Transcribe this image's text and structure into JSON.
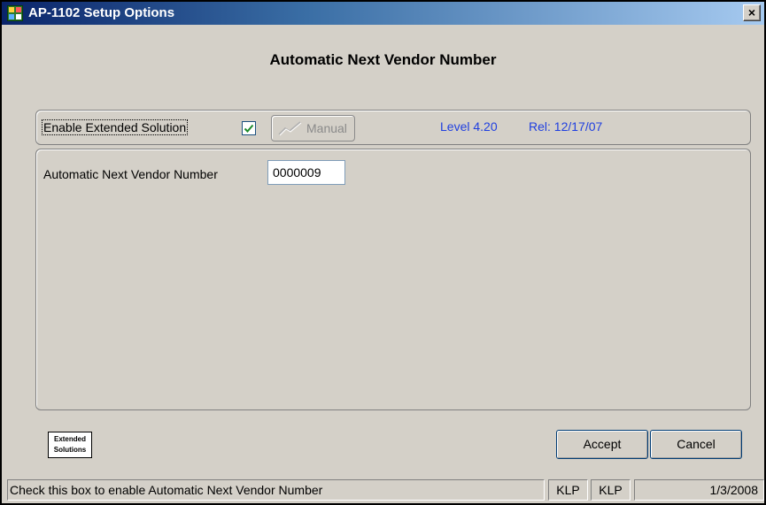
{
  "window": {
    "title": "AP-1102 Setup Options",
    "close_glyph": "×"
  },
  "heading": "Automatic Next Vendor Number",
  "options": {
    "enable_label": "Enable Extended Solution",
    "enable_checked": true,
    "manual_button": "Manual",
    "level": "Level 4.20",
    "release": "Rel: 12/17/07"
  },
  "fields": {
    "vendor_label": "Automatic Next Vendor Number",
    "vendor_value": "0000009"
  },
  "logo": {
    "line1": "Extended",
    "line2": "Solutions"
  },
  "buttons": {
    "accept": "Accept",
    "cancel": "Cancel"
  },
  "status": {
    "message": "Check this box to enable Automatic Next Vendor Number",
    "user1": "KLP",
    "user2": "KLP",
    "date": "1/3/2008"
  },
  "colors": {
    "titlebar_start": "#0a246a",
    "titlebar_end": "#a6caf0",
    "dialog_bg": "#d4d0c8",
    "info_text": "#1f3fe0",
    "checkmark": "#1c8a2a"
  },
  "icons": {
    "app": "app-icon",
    "close": "close-icon",
    "check": "checkmark-icon",
    "manual": "manual-icon"
  }
}
